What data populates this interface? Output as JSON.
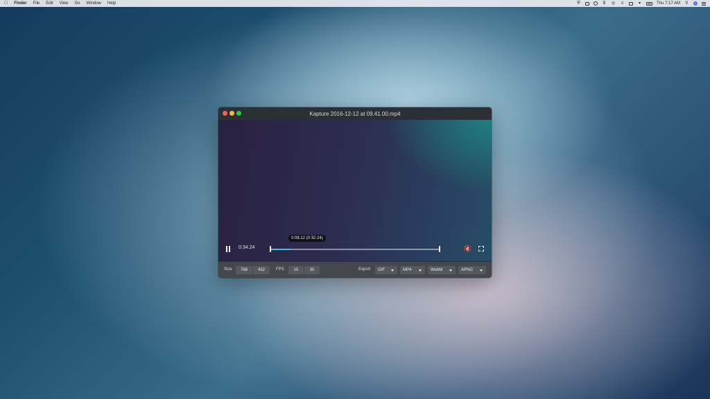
{
  "menubar": {
    "app_name": "Finder",
    "items": [
      "File",
      "Edit",
      "View",
      "Go",
      "Window",
      "Help"
    ],
    "clock": "Thu 7:17 AM",
    "status_icons": [
      "shield-icon",
      "cloud-icon",
      "circle-icon",
      "dollar-icon",
      "wifi-icon",
      "layers-icon",
      "display-icon",
      "volume-icon",
      "battery-icon",
      "search-icon",
      "siri-icon",
      "notification-list-icon"
    ]
  },
  "window": {
    "title": "Kapture 2016-12-12 at 09.41.00.mp4",
    "player": {
      "current_time": "0:34.24",
      "tooltip": "0:08.12 (0:32.24)",
      "progress": 0.123,
      "muted": true
    },
    "toolbar": {
      "size_label": "Size",
      "width": "768",
      "height": "432",
      "fps_label": "FPS",
      "fps_low": "15",
      "fps_high": "30",
      "export_label": "Export",
      "formats": [
        "GIF",
        "MP4",
        "WebM",
        "APNG"
      ]
    }
  },
  "colors": {
    "accent_progress": "#46c2e6",
    "close": "#fc5f57",
    "minimize": "#fdbc2e",
    "maximize": "#28c840"
  }
}
